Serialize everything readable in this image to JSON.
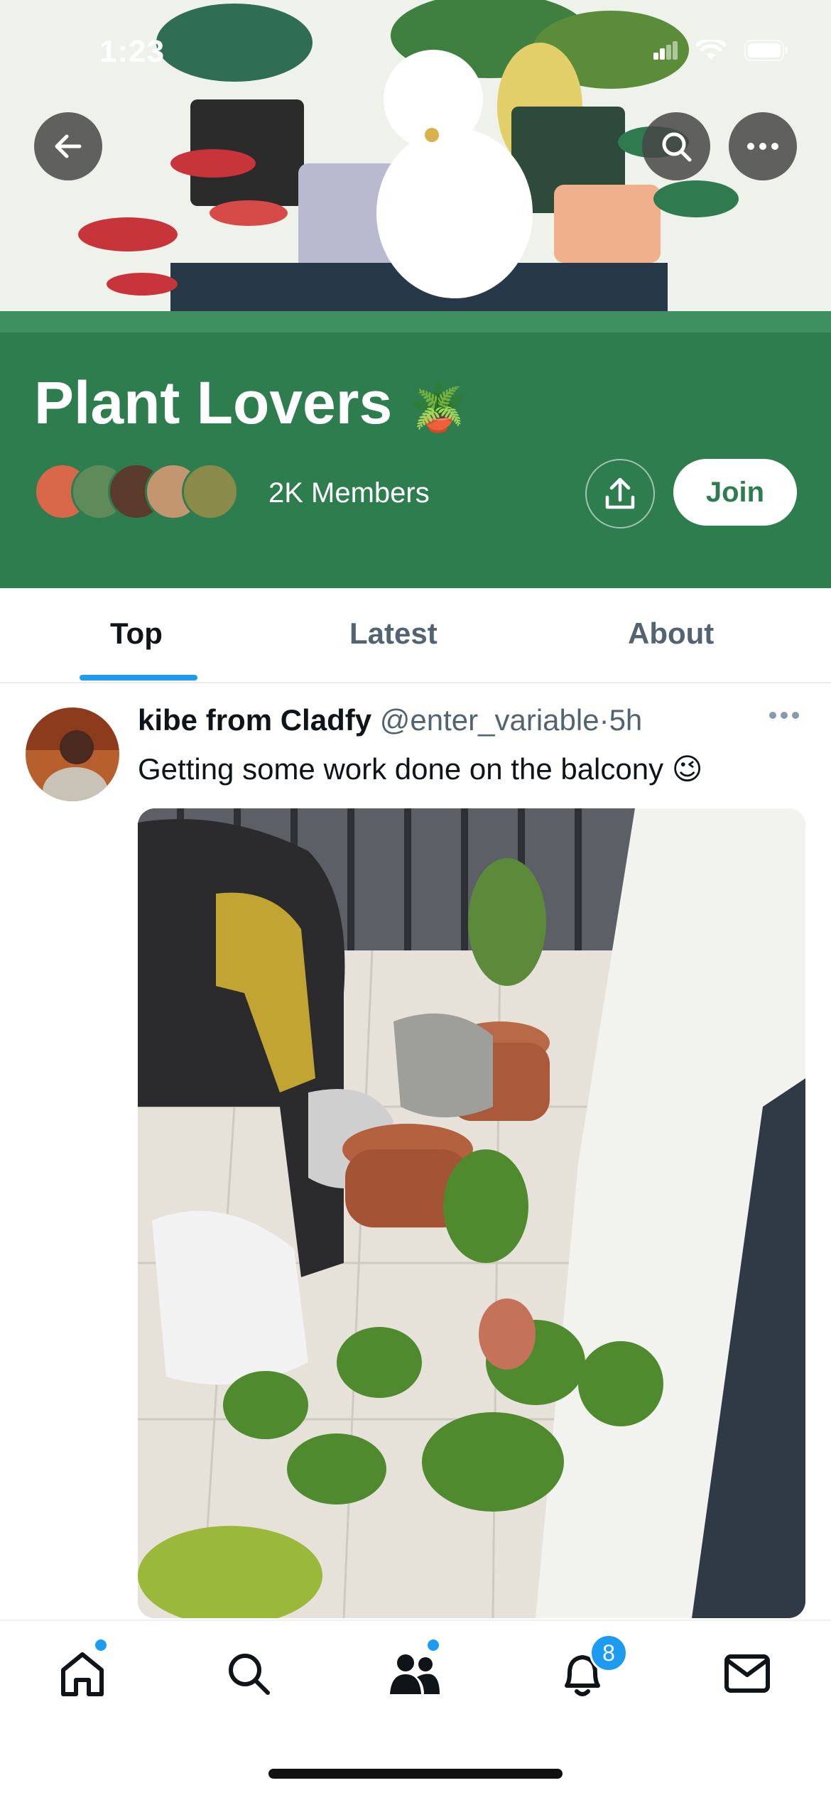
{
  "status_bar": {
    "time": "1:23"
  },
  "community": {
    "title": "Plant Lovers",
    "title_emoji": "🪴",
    "members_label": "2K Members",
    "join_label": "Join",
    "brand_color": "#2e7d4f"
  },
  "tabs": [
    {
      "label": "Top",
      "active": true
    },
    {
      "label": "Latest",
      "active": false
    },
    {
      "label": "About",
      "active": false
    }
  ],
  "post": {
    "author_name": "kibe from Cladfy",
    "handle": "@enter_variable",
    "separator": "·",
    "time": "5h",
    "text": "Getting some work done on the balcony 😉"
  },
  "bottom_nav": {
    "items": [
      "home-icon",
      "search-icon",
      "communities-icon",
      "notifications-icon",
      "messages-icon"
    ],
    "notifications_badge": "8"
  }
}
